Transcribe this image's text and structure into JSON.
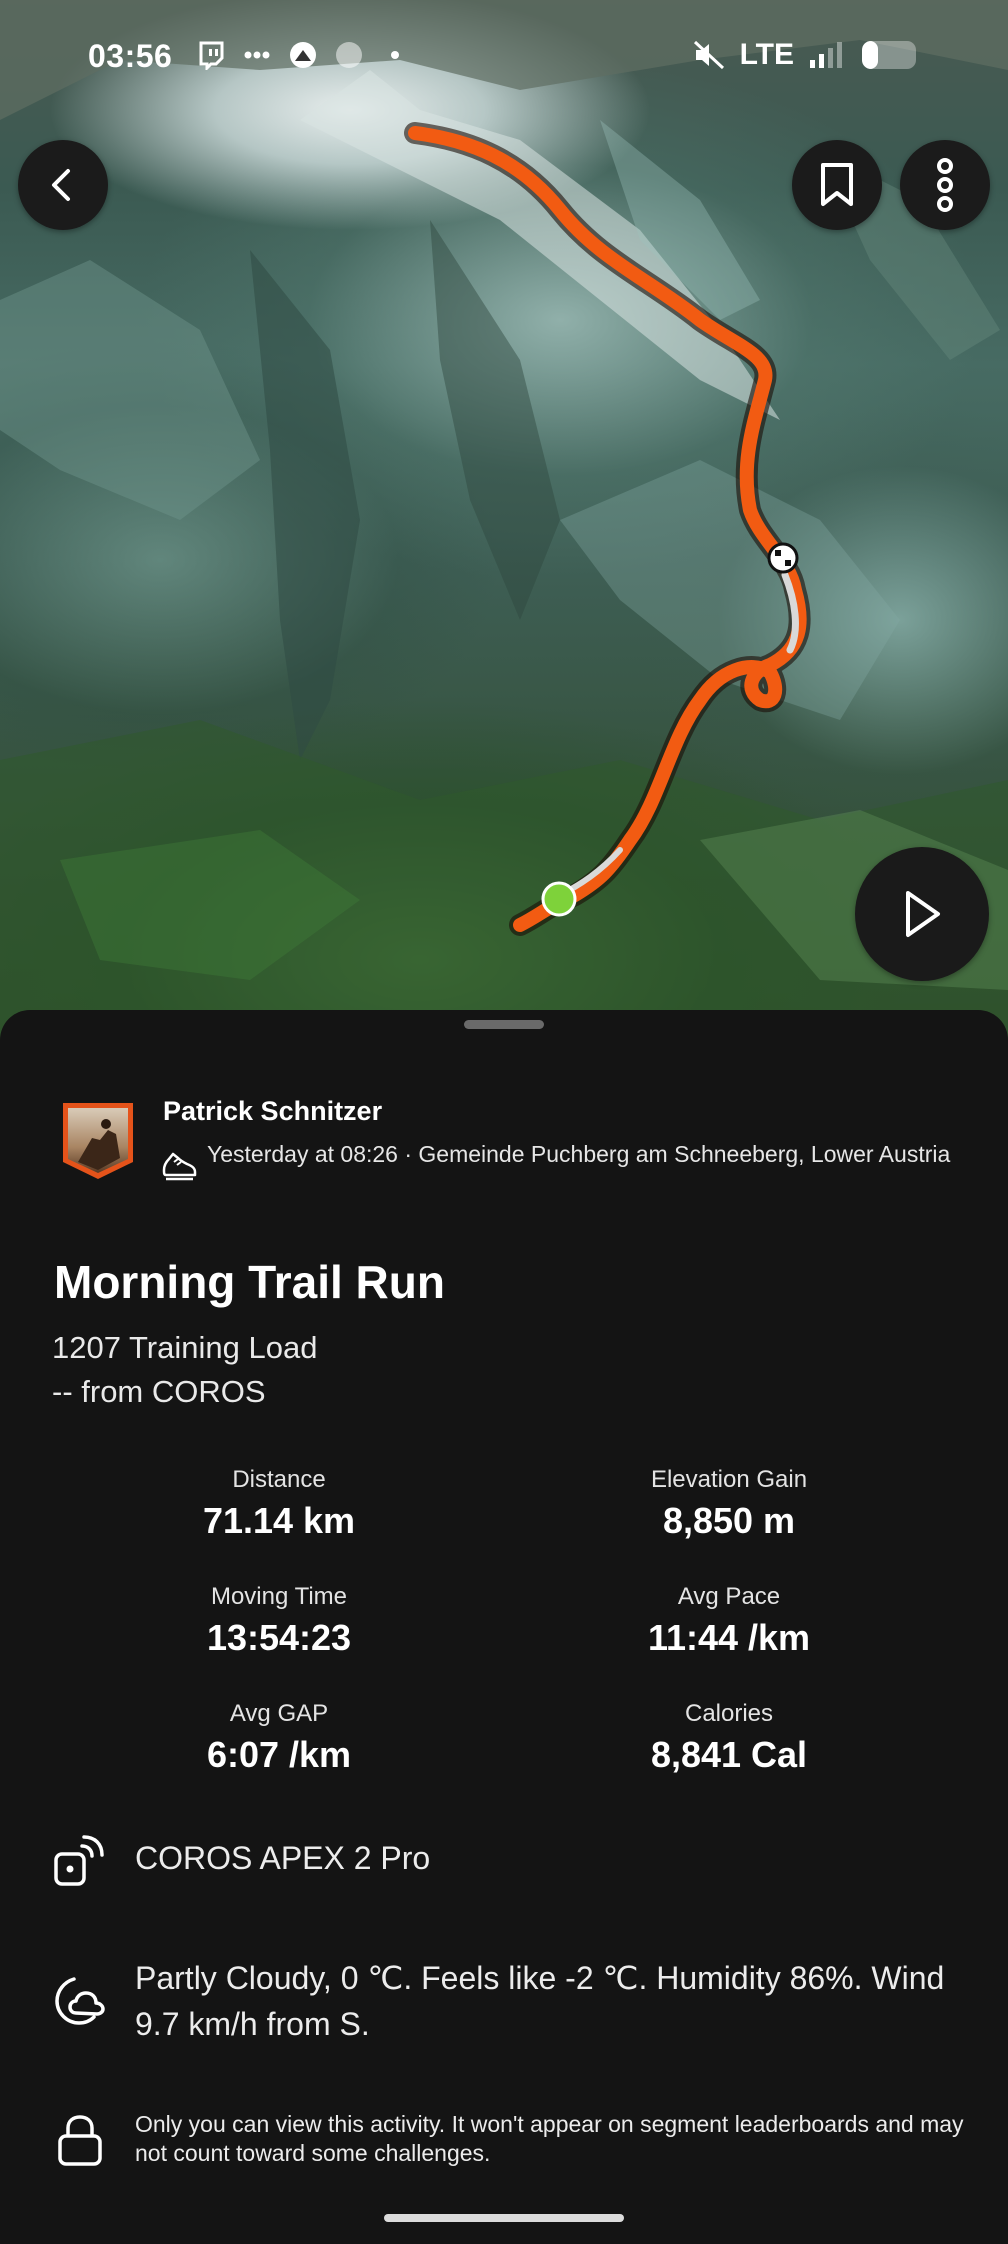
{
  "status_bar": {
    "time": "03:56",
    "network": "LTE",
    "battery_level": 0.3
  },
  "map": {
    "route_color": "#f25b12",
    "start_marker_color": "#7ed23a",
    "icons": {
      "back": "chevron-left-icon",
      "bookmark": "bookmark-icon",
      "more": "more-vertical-icon",
      "play": "play-icon"
    }
  },
  "athlete": {
    "name": "Patrick Schnitzer",
    "meta": "Yesterday at 08:26 · Gemeinde Puchberg am Schneeberg, Lower Austria",
    "sport_icon": "running-shoe-icon"
  },
  "activity": {
    "title": "Morning Trail Run",
    "training_load": "1207 Training Load",
    "source": "-- from COROS"
  },
  "stats": [
    {
      "label": "Distance",
      "value": "71.14 km"
    },
    {
      "label": "Elevation Gain",
      "value": "8,850 m"
    },
    {
      "label": "Moving Time",
      "value": "13:54:23"
    },
    {
      "label": "Avg Pace",
      "value": "11:44 /km"
    },
    {
      "label": "Avg GAP",
      "value": "6:07 /km"
    },
    {
      "label": "Calories",
      "value": "8,841 Cal"
    }
  ],
  "device": {
    "name": "COROS APEX 2 Pro",
    "icon": "watch-icon"
  },
  "weather": {
    "text": "Partly Cloudy, 0 ℃. Feels like -2 ℃. Humidity 86%. Wind 9.7 km/h from S.",
    "icon": "partly-cloudy-night-icon"
  },
  "privacy": {
    "text": "Only you can view this activity. It won't appear on segment leaderboards and may not count toward some challenges.",
    "icon": "lock-icon"
  }
}
